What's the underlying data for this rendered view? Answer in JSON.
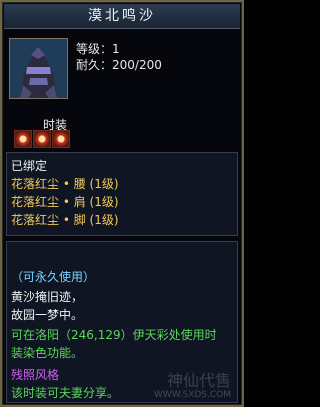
{
  "title": "漠北鸣沙",
  "stats": {
    "level_label": "等级：",
    "level_value": "1",
    "durability_label": "耐久：",
    "durability_value": "200/200"
  },
  "equip_label": "时装",
  "bound_text": "已绑定",
  "set_items": [
    {
      "text": "花落红尘 • 腰 (1级)"
    },
    {
      "text": "花落红尘 • 肩 (1级)"
    },
    {
      "text": "花落红尘 • 脚 (1级)"
    }
  ],
  "notes": {
    "permanent": "（可永久使用）",
    "poem1": "黄沙掩旧迹，",
    "poem2": "故园一梦中。",
    "location1": "可在洛阳（246,129）伊天彩处使用时",
    "location2": "装染色功能。",
    "style": "残照风格",
    "share": "该时装可夫妻分享。"
  },
  "watermark": {
    "title": "神仙代售",
    "site": "WWW.SXDS.COM"
  },
  "colors": {
    "gold": "#f2c85a",
    "aqua": "#74d8ff",
    "green": "#5cd75a",
    "pink": "#d062f5"
  }
}
